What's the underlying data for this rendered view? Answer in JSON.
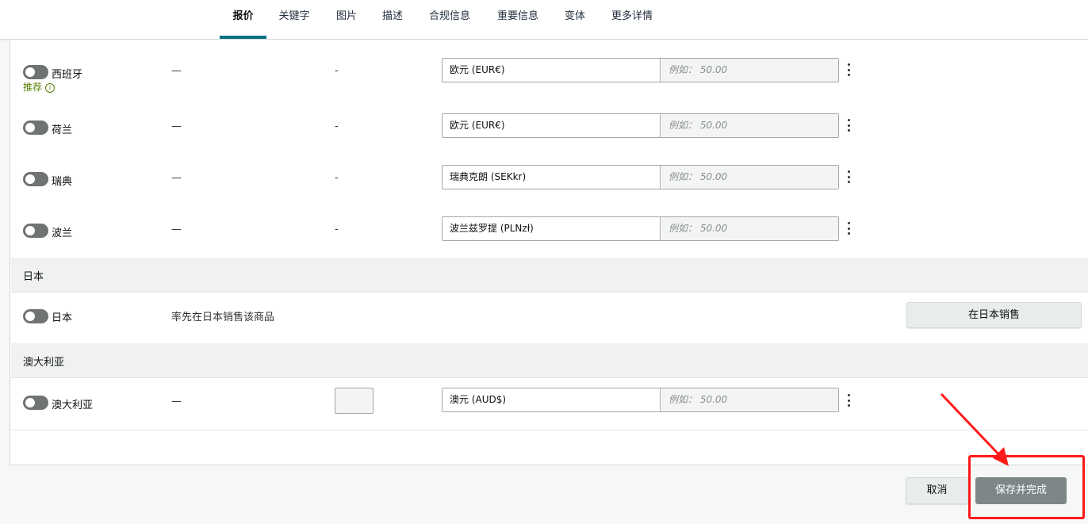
{
  "tabs": [
    {
      "label": "报价",
      "active": true
    },
    {
      "label": "关键字"
    },
    {
      "label": "图片"
    },
    {
      "label": "描述"
    },
    {
      "label": "合规信息"
    },
    {
      "label": "重要信息"
    },
    {
      "label": "变体"
    },
    {
      "label": "更多详情"
    }
  ],
  "rows": [
    {
      "country": "西班牙",
      "recommend": "推荐",
      "col2": "—",
      "col3": "-",
      "currency": "欧元 (EUR€)",
      "placeholder": "例如： 50.00"
    },
    {
      "country": "荷兰",
      "col2": "—",
      "col3": "-",
      "currency": "欧元 (EUR€)",
      "placeholder": "例如： 50.00"
    },
    {
      "country": "瑞典",
      "col2": "—",
      "col3": "-",
      "currency": "瑞典克朗 (SEKkr)",
      "placeholder": "例如： 50.00"
    },
    {
      "country": "波兰",
      "col2": "—",
      "col3": "-",
      "currency": "波兰兹罗提 (PLNzł)",
      "placeholder": "例如： 50.00"
    }
  ],
  "japan": {
    "section_title": "日本",
    "country": "日本",
    "description": "率先在日本销售该商品",
    "sell_button": "在日本销售"
  },
  "australia": {
    "section_title": "澳大利亚",
    "country": "澳大利亚",
    "col2": "—",
    "currency": "澳元 (AUD$)",
    "placeholder": "例如： 50.00"
  },
  "footer": {
    "cancel": "取消",
    "save": "保存并完成"
  },
  "colors": {
    "accent": "#007185",
    "highlight": "#ff1a1a",
    "recommend": "#567d00"
  }
}
